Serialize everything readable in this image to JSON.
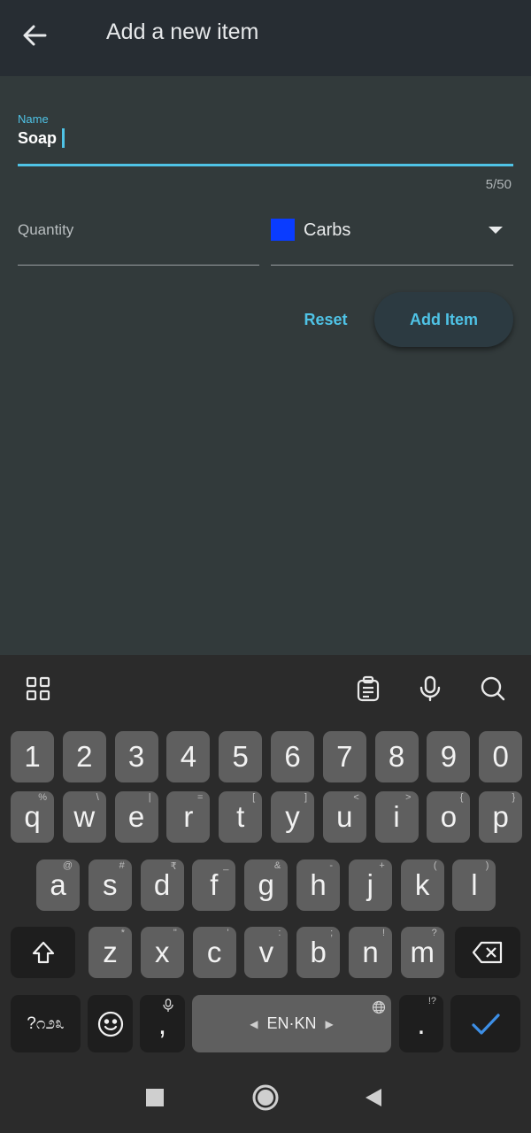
{
  "header": {
    "title": "Add a new item",
    "back_icon": "arrow-left-icon"
  },
  "form": {
    "name_label": "Name",
    "name_value": "Soap",
    "char_counter": "5/50",
    "quantity_label": "Quantity",
    "category_value": "Carbs",
    "category_color": "#0a3cff",
    "reset_label": "Reset",
    "add_label": "Add Item",
    "accent_color": "#4fc3e6"
  },
  "keyboard": {
    "toolbar_icons": [
      "apps-grid-icon",
      "clipboard-icon",
      "microphone-icon",
      "search-icon"
    ],
    "number_row": [
      "1",
      "2",
      "3",
      "4",
      "5",
      "6",
      "7",
      "8",
      "9",
      "0"
    ],
    "row1": [
      {
        "k": "q",
        "h": "%"
      },
      {
        "k": "w",
        "h": "\\"
      },
      {
        "k": "e",
        "h": "|"
      },
      {
        "k": "r",
        "h": "="
      },
      {
        "k": "t",
        "h": "["
      },
      {
        "k": "y",
        "h": "]"
      },
      {
        "k": "u",
        "h": "<"
      },
      {
        "k": "i",
        "h": ">"
      },
      {
        "k": "o",
        "h": "{"
      },
      {
        "k": "p",
        "h": "}"
      }
    ],
    "row2": [
      {
        "k": "a",
        "h": "@"
      },
      {
        "k": "s",
        "h": "#"
      },
      {
        "k": "d",
        "h": "₹"
      },
      {
        "k": "f",
        "h": "_"
      },
      {
        "k": "g",
        "h": "&"
      },
      {
        "k": "h",
        "h": "-"
      },
      {
        "k": "j",
        "h": "+"
      },
      {
        "k": "k",
        "h": "("
      },
      {
        "k": "l",
        "h": ")"
      }
    ],
    "row3": [
      {
        "k": "z",
        "h": "*"
      },
      {
        "k": "x",
        "h": "\""
      },
      {
        "k": "c",
        "h": "'"
      },
      {
        "k": "v",
        "h": ":"
      },
      {
        "k": "b",
        "h": ";"
      },
      {
        "k": "n",
        "h": "!"
      },
      {
        "k": "m",
        "h": "?"
      }
    ],
    "symbols_label": "?೧೨೩",
    "comma": ",",
    "space_label": "EN·KN",
    "period": ".",
    "period_hint": "!?"
  },
  "navbar": {
    "icons": [
      "recents-square-icon",
      "home-circle-icon",
      "back-triangle-icon"
    ]
  }
}
